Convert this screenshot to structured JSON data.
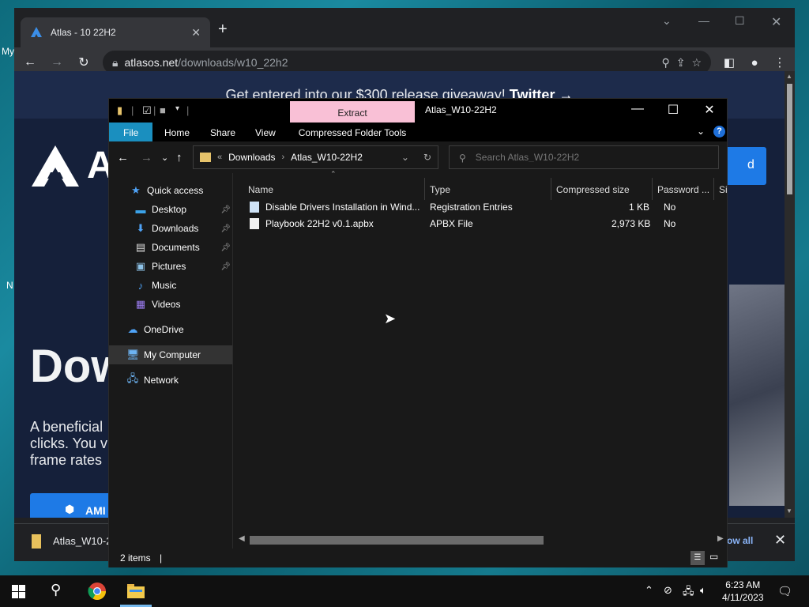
{
  "desktop": {
    "left_labels": [
      "My",
      "N"
    ]
  },
  "chrome": {
    "tab_title": "Atlas - 10 22H2",
    "url_host": "atlasos.net",
    "url_path": "/downloads/w10_22h2",
    "banner_text": "Get entered into our $300 release giveaway!",
    "banner_link": "Twitter →",
    "logo_text": "A",
    "download_btn_partial": "d",
    "big_title": "Dow",
    "desc_lines": [
      "A beneficial",
      "clicks. You v",
      "frame rates"
    ],
    "amd_btn": "AMI",
    "download_bar": {
      "file_name": "Atlas_W10-2",
      "show_all": "ow all"
    }
  },
  "explorer": {
    "title": "Atlas_W10-22H2",
    "extract_tab": "Extract",
    "ribbon_tabs": [
      "File",
      "Home",
      "Share",
      "View"
    ],
    "compressed_tools": "Compressed Folder Tools",
    "breadcrumb": {
      "lead": "«",
      "items": [
        "Downloads",
        "Atlas_W10-22H2"
      ]
    },
    "search_placeholder": "Search Atlas_W10-22H2",
    "nav": {
      "quick_access": "Quick access",
      "items": [
        "Desktop",
        "Downloads",
        "Documents",
        "Pictures",
        "Music",
        "Videos"
      ],
      "onedrive": "OneDrive",
      "my_computer": "My Computer",
      "network": "Network"
    },
    "columns": [
      "Name",
      "Type",
      "Compressed size",
      "Password ...",
      "Si"
    ],
    "files": [
      {
        "name": "Disable Drivers Installation in Wind...",
        "type": "Registration Entries",
        "size": "1 KB",
        "password": "No"
      },
      {
        "name": "Playbook 22H2 v0.1.apbx",
        "type": "APBX File",
        "size": "2,973 KB",
        "password": "No"
      }
    ],
    "status": "2 items"
  },
  "taskbar": {
    "time": "6:23 AM",
    "date": "4/11/2023"
  },
  "colors": {
    "accent": "#1a8fbf",
    "extract_tab": "#f9c0d6",
    "chrome_bg": "#202124"
  }
}
